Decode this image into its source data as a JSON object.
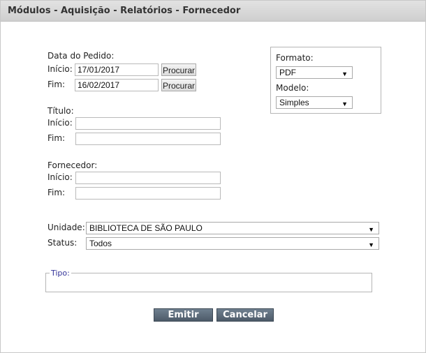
{
  "window": {
    "title": "Módulos - Aquisição - Relatórios - Fornecedor"
  },
  "data_pedido": {
    "label": "Data do Pedido:",
    "inicio_label": "Início:",
    "inicio_value": "17/01/2017",
    "fim_label": "Fim:",
    "fim_value": "16/02/2017",
    "procurar_label": "Procurar"
  },
  "titulo": {
    "label": "Título:",
    "inicio_label": "Início:",
    "fim_label": "Fim:",
    "inicio_value": "",
    "fim_value": ""
  },
  "fornecedor": {
    "label": "Fornecedor:",
    "inicio_label": "Início:",
    "fim_label": "Fim:",
    "inicio_value": "",
    "fim_value": ""
  },
  "unidade": {
    "label": "Unidade:",
    "selected": "BIBLIOTECA DE SÃO PAULO"
  },
  "status": {
    "label": "Status:",
    "selected": "Todos"
  },
  "formato": {
    "label": "Formato:",
    "selected": "PDF"
  },
  "modelo": {
    "label": "Modelo:",
    "selected": "Simples"
  },
  "tipo": {
    "legend": "Tipo:"
  },
  "actions": {
    "emitir": "Emitir",
    "cancelar": "Cancelar"
  },
  "icons": {
    "dropdown_arrow": "▼"
  }
}
